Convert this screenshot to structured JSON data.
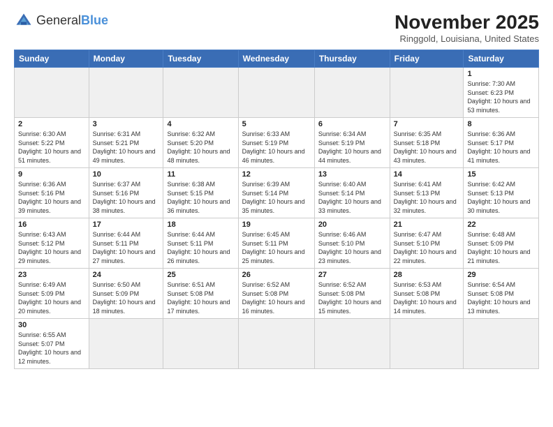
{
  "header": {
    "logo_general": "General",
    "logo_blue": "Blue",
    "month_year": "November 2025",
    "location": "Ringgold, Louisiana, United States"
  },
  "days_of_week": [
    "Sunday",
    "Monday",
    "Tuesday",
    "Wednesday",
    "Thursday",
    "Friday",
    "Saturday"
  ],
  "weeks": [
    [
      {
        "day": "",
        "empty": true
      },
      {
        "day": "",
        "empty": true
      },
      {
        "day": "",
        "empty": true
      },
      {
        "day": "",
        "empty": true
      },
      {
        "day": "",
        "empty": true
      },
      {
        "day": "",
        "empty": true
      },
      {
        "day": "1",
        "sunrise": "7:30 AM",
        "sunset": "6:23 PM",
        "daylight": "10 hours and 53 minutes."
      }
    ],
    [
      {
        "day": "2",
        "sunrise": "6:30 AM",
        "sunset": "5:22 PM",
        "daylight": "10 hours and 51 minutes."
      },
      {
        "day": "3",
        "sunrise": "6:31 AM",
        "sunset": "5:21 PM",
        "daylight": "10 hours and 49 minutes."
      },
      {
        "day": "4",
        "sunrise": "6:32 AM",
        "sunset": "5:20 PM",
        "daylight": "10 hours and 48 minutes."
      },
      {
        "day": "5",
        "sunrise": "6:33 AM",
        "sunset": "5:19 PM",
        "daylight": "10 hours and 46 minutes."
      },
      {
        "day": "6",
        "sunrise": "6:34 AM",
        "sunset": "5:19 PM",
        "daylight": "10 hours and 44 minutes."
      },
      {
        "day": "7",
        "sunrise": "6:35 AM",
        "sunset": "5:18 PM",
        "daylight": "10 hours and 43 minutes."
      },
      {
        "day": "8",
        "sunrise": "6:36 AM",
        "sunset": "5:17 PM",
        "daylight": "10 hours and 41 minutes."
      }
    ],
    [
      {
        "day": "9",
        "sunrise": "6:36 AM",
        "sunset": "5:16 PM",
        "daylight": "10 hours and 39 minutes."
      },
      {
        "day": "10",
        "sunrise": "6:37 AM",
        "sunset": "5:16 PM",
        "daylight": "10 hours and 38 minutes."
      },
      {
        "day": "11",
        "sunrise": "6:38 AM",
        "sunset": "5:15 PM",
        "daylight": "10 hours and 36 minutes."
      },
      {
        "day": "12",
        "sunrise": "6:39 AM",
        "sunset": "5:14 PM",
        "daylight": "10 hours and 35 minutes."
      },
      {
        "day": "13",
        "sunrise": "6:40 AM",
        "sunset": "5:14 PM",
        "daylight": "10 hours and 33 minutes."
      },
      {
        "day": "14",
        "sunrise": "6:41 AM",
        "sunset": "5:13 PM",
        "daylight": "10 hours and 32 minutes."
      },
      {
        "day": "15",
        "sunrise": "6:42 AM",
        "sunset": "5:13 PM",
        "daylight": "10 hours and 30 minutes."
      }
    ],
    [
      {
        "day": "16",
        "sunrise": "6:43 AM",
        "sunset": "5:12 PM",
        "daylight": "10 hours and 29 minutes."
      },
      {
        "day": "17",
        "sunrise": "6:44 AM",
        "sunset": "5:11 PM",
        "daylight": "10 hours and 27 minutes."
      },
      {
        "day": "18",
        "sunrise": "6:44 AM",
        "sunset": "5:11 PM",
        "daylight": "10 hours and 26 minutes."
      },
      {
        "day": "19",
        "sunrise": "6:45 AM",
        "sunset": "5:11 PM",
        "daylight": "10 hours and 25 minutes."
      },
      {
        "day": "20",
        "sunrise": "6:46 AM",
        "sunset": "5:10 PM",
        "daylight": "10 hours and 23 minutes."
      },
      {
        "day": "21",
        "sunrise": "6:47 AM",
        "sunset": "5:10 PM",
        "daylight": "10 hours and 22 minutes."
      },
      {
        "day": "22",
        "sunrise": "6:48 AM",
        "sunset": "5:09 PM",
        "daylight": "10 hours and 21 minutes."
      }
    ],
    [
      {
        "day": "23",
        "sunrise": "6:49 AM",
        "sunset": "5:09 PM",
        "daylight": "10 hours and 20 minutes."
      },
      {
        "day": "24",
        "sunrise": "6:50 AM",
        "sunset": "5:09 PM",
        "daylight": "10 hours and 18 minutes."
      },
      {
        "day": "25",
        "sunrise": "6:51 AM",
        "sunset": "5:08 PM",
        "daylight": "10 hours and 17 minutes."
      },
      {
        "day": "26",
        "sunrise": "6:52 AM",
        "sunset": "5:08 PM",
        "daylight": "10 hours and 16 minutes."
      },
      {
        "day": "27",
        "sunrise": "6:52 AM",
        "sunset": "5:08 PM",
        "daylight": "10 hours and 15 minutes."
      },
      {
        "day": "28",
        "sunrise": "6:53 AM",
        "sunset": "5:08 PM",
        "daylight": "10 hours and 14 minutes."
      },
      {
        "day": "29",
        "sunrise": "6:54 AM",
        "sunset": "5:08 PM",
        "daylight": "10 hours and 13 minutes."
      }
    ],
    [
      {
        "day": "30",
        "sunrise": "6:55 AM",
        "sunset": "5:07 PM",
        "daylight": "10 hours and 12 minutes."
      },
      {
        "day": "",
        "empty": true
      },
      {
        "day": "",
        "empty": true
      },
      {
        "day": "",
        "empty": true
      },
      {
        "day": "",
        "empty": true
      },
      {
        "day": "",
        "empty": true
      },
      {
        "day": "",
        "empty": true
      }
    ]
  ]
}
